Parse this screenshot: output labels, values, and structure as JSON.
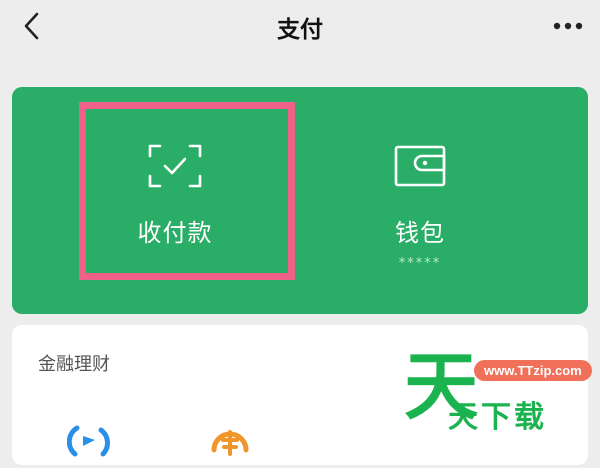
{
  "nav": {
    "title": "支付",
    "back_icon": "chevron-left-icon",
    "more_icon": "more-dots-icon"
  },
  "actions": [
    {
      "label": "收付款",
      "icon": "scan-check-icon"
    },
    {
      "label": "钱包",
      "icon": "wallet-icon",
      "masked": "*****"
    }
  ],
  "finance": {
    "title": "金融理财"
  },
  "watermark": {
    "url": "www.TTzip.com",
    "big": "天",
    "small": "天下载"
  },
  "colors": {
    "card_green": "#2aae67",
    "highlight": "#f0618a",
    "background": "#ededed"
  }
}
